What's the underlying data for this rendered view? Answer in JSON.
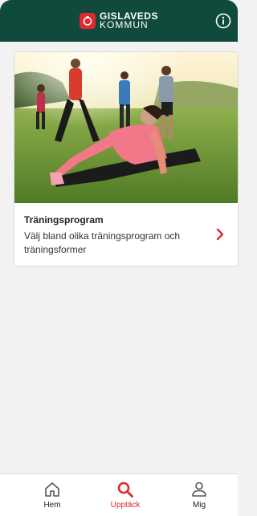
{
  "header": {
    "logo_line1": "GISLAVEDS",
    "logo_line2": "KOMMUN",
    "info_icon": "info-circle-icon",
    "colors": {
      "background": "#0f4a3c",
      "logo_badge": "#e0282e"
    }
  },
  "card": {
    "image_icon": "outdoor-stretching-photo",
    "title": "Träningsprogram",
    "description": "Välj bland olika träningsprogram och träningsformer",
    "chevron_icon": "chevron-right-icon"
  },
  "tabs": [
    {
      "label": "Hem",
      "icon": "home-icon",
      "active": false
    },
    {
      "label": "Upptäck",
      "icon": "search-icon",
      "active": true
    },
    {
      "label": "Mig",
      "icon": "person-icon",
      "active": false
    }
  ],
  "colors": {
    "accent": "#e0282e",
    "page_background": "#f2f2f2"
  }
}
